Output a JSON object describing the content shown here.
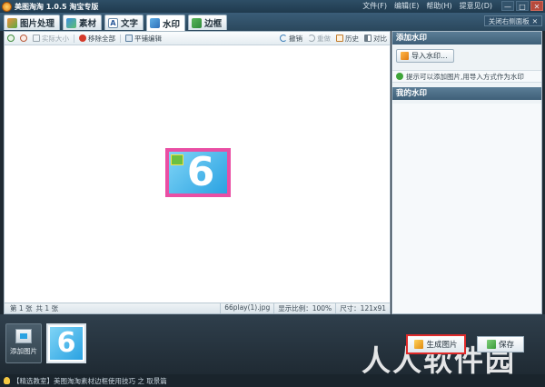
{
  "titlebar": {
    "title": "美图淘淘 1.0.5 淘宝专版",
    "menus": [
      "文件(F)",
      "编辑(E)",
      "帮助(H)",
      "提意见(D)"
    ],
    "min": "—",
    "max": "□",
    "close": "✕"
  },
  "tabs": [
    {
      "label": "图片处理",
      "icon": "photo-icon"
    },
    {
      "label": "素材",
      "icon": "material-icon"
    },
    {
      "label": "文字",
      "icon": "text-icon"
    },
    {
      "label": "水印",
      "icon": "watermark-icon",
      "active": true
    },
    {
      "label": "边框",
      "icon": "frame-icon"
    }
  ],
  "side_toggle": {
    "label": "关闭右侧面板",
    "icon": "✕"
  },
  "toolbar": {
    "zoom_in": "",
    "zoom_out": "",
    "actual_size": "实际大小",
    "fit_window": "移除全部",
    "compare": "平铺编辑",
    "undo": "撤销",
    "redo": "重做",
    "history": "历史",
    "contrast": "对比"
  },
  "canvas": {
    "image_label": "6"
  },
  "statusbar": {
    "page": "第 1 张",
    "total": "共 1 张",
    "filename": "66play(1).jpg",
    "scale": "显示比例：100%",
    "size": "尺寸：121x91"
  },
  "panel": {
    "add_header": "添加水印",
    "open_button": "导入水印...",
    "tip": "提示可以添加图片,用导入方式作为水印",
    "my_header": "我的水印"
  },
  "bottom": {
    "add_photo": "添加图片",
    "thumb_label": "6",
    "generate_button": "生成图片",
    "save_button": "保存",
    "brand_watermark": "人人软件园"
  },
  "infobar": {
    "text": "【精选教室】美图淘淘素材边框使用技巧 之 取景篇"
  },
  "colors": {
    "accent": "#3f6079",
    "highlight": "#e02a2a",
    "image_border": "#e94fa4"
  }
}
